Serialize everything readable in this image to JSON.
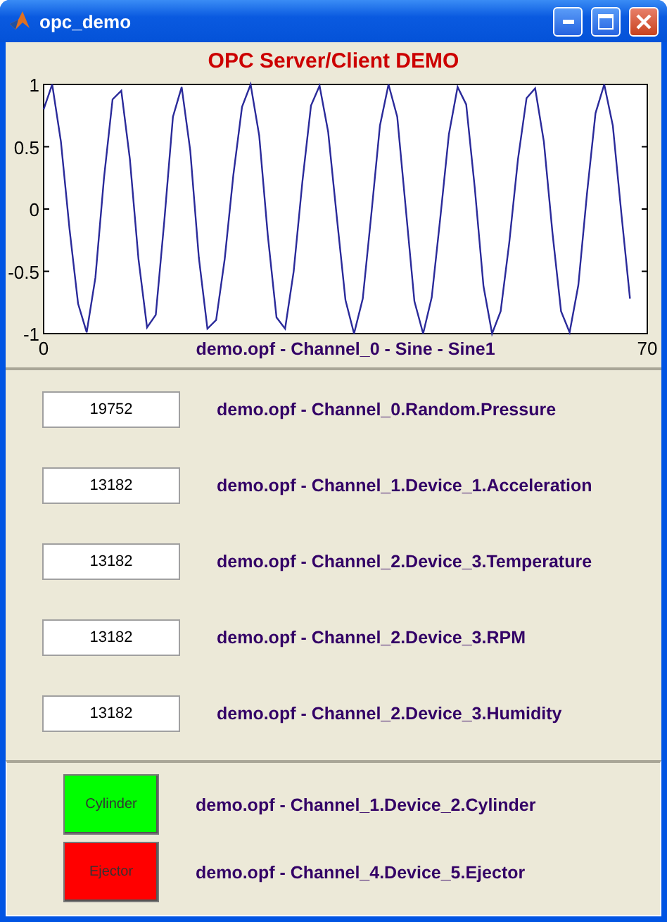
{
  "window": {
    "title": "opc_demo"
  },
  "chart": {
    "chart_data": {
      "type": "line",
      "title": "OPC Server/Client DEMO",
      "xlabel": "demo.opf - Channel_0 - Sine - Sine1",
      "xlim": [
        0,
        70
      ],
      "ylim": [
        -1,
        1
      ],
      "xticks": [
        0,
        70
      ],
      "yticks": [
        -1,
        -0.5,
        0,
        0.5,
        1
      ],
      "x": [
        0,
        1,
        2,
        3,
        4,
        5,
        6,
        7,
        8,
        9,
        10,
        11,
        12,
        13,
        14,
        15,
        16,
        17,
        18,
        19,
        20,
        21,
        22,
        23,
        24,
        25,
        26,
        27,
        28,
        29,
        30,
        31,
        32,
        33,
        34,
        35,
        36,
        37,
        38,
        39,
        40,
        41,
        42,
        43,
        44,
        45,
        46,
        47,
        48,
        49,
        50,
        51,
        52,
        53,
        54,
        55,
        56,
        57,
        58,
        59,
        60,
        61,
        62,
        63,
        64,
        65,
        66,
        67,
        68
      ],
      "series": [
        {
          "color": "#2a2a9a",
          "values": [
            0.8,
            1.0,
            0.54,
            -0.16,
            -0.76,
            -0.99,
            -0.55,
            0.25,
            0.88,
            0.95,
            0.4,
            -0.4,
            -0.95,
            -0.85,
            -0.09,
            0.74,
            0.98,
            0.47,
            -0.39,
            -0.96,
            -0.89,
            -0.4,
            0.27,
            0.82,
            1.0,
            0.59,
            -0.21,
            -0.87,
            -0.96,
            -0.5,
            0.22,
            0.83,
            0.99,
            0.62,
            -0.07,
            -0.73,
            -1.0,
            -0.72,
            -0.04,
            0.67,
            1.0,
            0.74,
            0.0,
            -0.74,
            -1.0,
            -0.71,
            -0.07,
            0.6,
            0.98,
            0.84,
            0.17,
            -0.62,
            -1.0,
            -0.82,
            -0.27,
            0.4,
            0.89,
            0.97,
            0.54,
            -0.19,
            -0.82,
            -0.99,
            -0.61,
            0.12,
            0.77,
            1.0,
            0.67,
            -0.04,
            -0.72
          ]
        }
      ]
    }
  },
  "readings": [
    {
      "value": "19752",
      "label": "demo.opf - Channel_0.Random.Pressure"
    },
    {
      "value": "13182",
      "label": "demo.opf - Channel_1.Device_1.Acceleration"
    },
    {
      "value": "13182",
      "label": "demo.opf - Channel_2.Device_3.Temperature"
    },
    {
      "value": "13182",
      "label": "demo.opf - Channel_2.Device_3.RPM"
    },
    {
      "value": "13182",
      "label": "demo.opf - Channel_2.Device_3.Humidity"
    }
  ],
  "indicators": [
    {
      "text": "Cylinder",
      "color": "#00ff00",
      "label": "demo.opf - Channel_1.Device_2.Cylinder"
    },
    {
      "text": "Ejector",
      "color": "#ff0000",
      "label": "demo.opf - Channel_4.Device_5.Ejector"
    }
  ]
}
